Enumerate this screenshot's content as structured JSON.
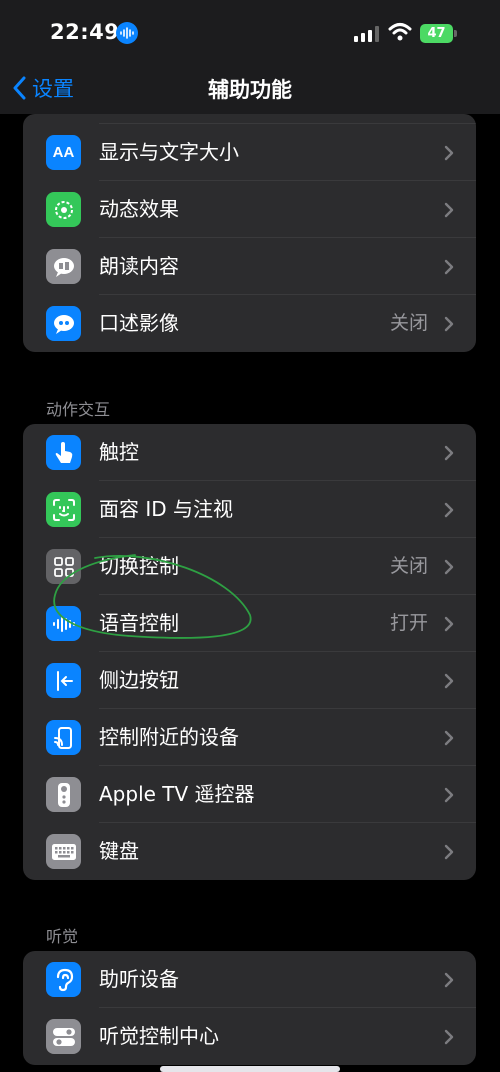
{
  "status_bar": {
    "time": "22:49",
    "battery": "47"
  },
  "nav": {
    "back_label": "设置",
    "title": "辅助功能"
  },
  "group1": [
    {
      "label": "显示与文字大小",
      "value": "",
      "icon": "text-size-icon",
      "color": "#0a84ff"
    },
    {
      "label": "动态效果",
      "value": "",
      "icon": "motion-icon",
      "color": "#34c759"
    },
    {
      "label": "朗读内容",
      "value": "",
      "icon": "speech-bubble-icon",
      "color": "#8e8e93"
    },
    {
      "label": "口述影像",
      "value": "关闭",
      "icon": "audio-description-icon",
      "color": "#0a84ff"
    }
  ],
  "section_motion": "动作交互",
  "group2": [
    {
      "label": "触控",
      "value": "",
      "icon": "hand-touch-icon",
      "color": "#0a84ff"
    },
    {
      "label": "面容 ID 与注视",
      "value": "",
      "icon": "face-id-icon",
      "color": "#34c759"
    },
    {
      "label": "切换控制",
      "value": "关闭",
      "icon": "switch-grid-icon",
      "color": "#636366"
    },
    {
      "label": "语音控制",
      "value": "打开",
      "icon": "voice-waveform-icon",
      "color": "#0a84ff"
    },
    {
      "label": "侧边按钮",
      "value": "",
      "icon": "side-button-icon",
      "color": "#0a84ff"
    },
    {
      "label": "控制附近的设备",
      "value": "",
      "icon": "nearby-device-icon",
      "color": "#0a84ff"
    },
    {
      "label": "Apple TV 遥控器",
      "value": "",
      "icon": "remote-icon",
      "color": "#8e8e93"
    },
    {
      "label": "键盘",
      "value": "",
      "icon": "keyboard-icon",
      "color": "#8e8e93"
    }
  ],
  "section_hearing": "听觉",
  "group3": [
    {
      "label": "助听设备",
      "value": "",
      "icon": "ear-icon",
      "color": "#0a84ff"
    },
    {
      "label": "听觉控制中心",
      "value": "",
      "icon": "toggles-icon",
      "color": "#8e8e93"
    }
  ]
}
